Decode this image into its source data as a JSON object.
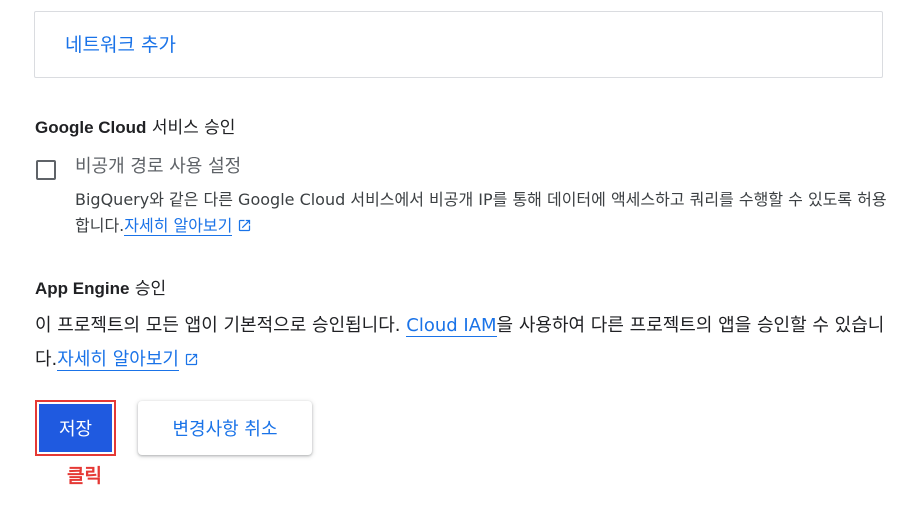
{
  "add_network": {
    "label": "네트워크 추가"
  },
  "google_cloud_section": {
    "title_en": "Google Cloud",
    "title_ko": " 서비스 승인",
    "checkbox_label": "비공개 경로 사용 설정",
    "checkbox_checked": false,
    "description": "BigQuery와 같은 다른 Google Cloud 서비스에서 비공개 IP를 통해 데이터에 액세스하고 쿼리를 수행할 수 있도록 허용합니다.",
    "learn_more": "자세히 알아보기"
  },
  "app_engine_section": {
    "title_en": "App Engine",
    "title_ko": " 승인",
    "description_part1": "이 프로젝트의 모든 앱이 기본적으로 승인됩니다. ",
    "cloud_iam_link": "Cloud IAM",
    "description_part2": "을 사용하여 다른 프로젝트의 앱을 승인할 수 있습니다.",
    "learn_more": "자세히 알아보기"
  },
  "actions": {
    "save_label": "저장",
    "cancel_label": "변경사항 취소"
  },
  "annotation": {
    "click_label": "클릭"
  },
  "colors": {
    "link": "#1a73e8",
    "primary_button": "#1f5ae0",
    "highlight": "#e53935"
  },
  "icons": {
    "external_link": "external-link-icon"
  }
}
